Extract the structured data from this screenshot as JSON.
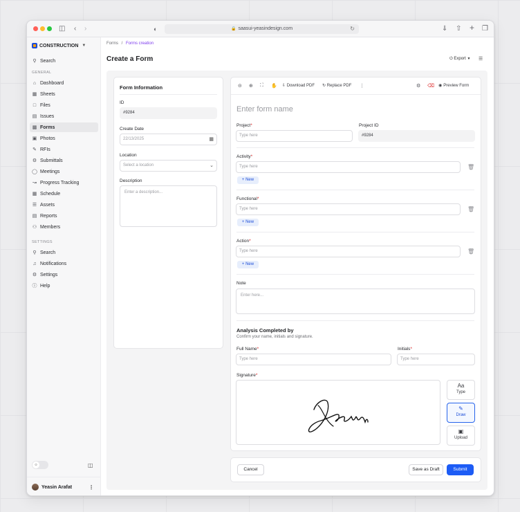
{
  "browser": {
    "url": "saasui-yeasindesign.com"
  },
  "sidebar": {
    "brand": "CONSTRUCTION",
    "search": "Search",
    "general_label": "GENERAL",
    "general_items": [
      {
        "label": "Dashboard",
        "icon": "home-icon"
      },
      {
        "label": "Sheets",
        "icon": "sheets-icon"
      },
      {
        "label": "Files",
        "icon": "file-icon"
      },
      {
        "label": "Issues",
        "icon": "issues-icon"
      },
      {
        "label": "Forms",
        "icon": "forms-icon",
        "active": true
      },
      {
        "label": "Photos",
        "icon": "photo-icon"
      },
      {
        "label": "RFIs",
        "icon": "rfi-icon"
      },
      {
        "label": "Submittals",
        "icon": "submittal-icon"
      },
      {
        "label": "Meetings",
        "icon": "meeting-icon"
      },
      {
        "label": "Progress Tracking",
        "icon": "progress-icon"
      },
      {
        "label": "Schedule",
        "icon": "calendar-icon"
      },
      {
        "label": "Assets",
        "icon": "assets-icon"
      },
      {
        "label": "Reports",
        "icon": "reports-icon"
      },
      {
        "label": "Members",
        "icon": "members-icon"
      }
    ],
    "settings_label": "SETTINGS",
    "settings_items": [
      {
        "label": "Search",
        "icon": "search-icon"
      },
      {
        "label": "Notifications",
        "icon": "bell-icon"
      },
      {
        "label": "Settings",
        "icon": "gear-icon"
      },
      {
        "label": "Help",
        "icon": "help-icon"
      }
    ],
    "user": "Yeasin Arafat"
  },
  "header": {
    "breadcrumb_root": "Forms",
    "breadcrumb_sep": "/",
    "breadcrumb_current": "Forms creation",
    "title": "Create a Form",
    "export": "Export"
  },
  "info": {
    "title": "Form Information",
    "id_label": "ID",
    "id_value": "#9284",
    "date_label": "Create Date",
    "date_value": "22/13/2025",
    "location_label": "Location",
    "location_placeholder": "Select a location",
    "description_label": "Description",
    "description_placeholder": "Enter a description..."
  },
  "toolbar": {
    "download": "Download PDF",
    "replace": "Replace PDF",
    "preview": "Preview Form"
  },
  "form": {
    "name_placeholder": "Enter form name",
    "project_label": "Project",
    "project_placeholder": "Type here",
    "project_id_label": "Project ID",
    "project_id_value": "#9284",
    "activity_label": "Activity",
    "functional_label": "Functional",
    "action_label": "Action",
    "type_here": "Type here",
    "new_label": "New",
    "note_label": "Note",
    "note_placeholder": "Enter here...",
    "analysis_title": "Analysis Completed by",
    "analysis_sub": "Confirm your name, initials and signature.",
    "fullname_label": "Full Name",
    "initials_label": "Initials",
    "signature_label": "Signature",
    "sig_type": "Type",
    "sig_draw": "Draw",
    "sig_upload": "Upload",
    "sig_type_glyph": "Aa"
  },
  "actions": {
    "cancel": "Cancel",
    "draft": "Save as Draft",
    "submit": "Submit"
  },
  "colors": {
    "primary": "#1d5cf5",
    "required": "#dc2626",
    "breadcrumb_active": "#7c3aed"
  }
}
